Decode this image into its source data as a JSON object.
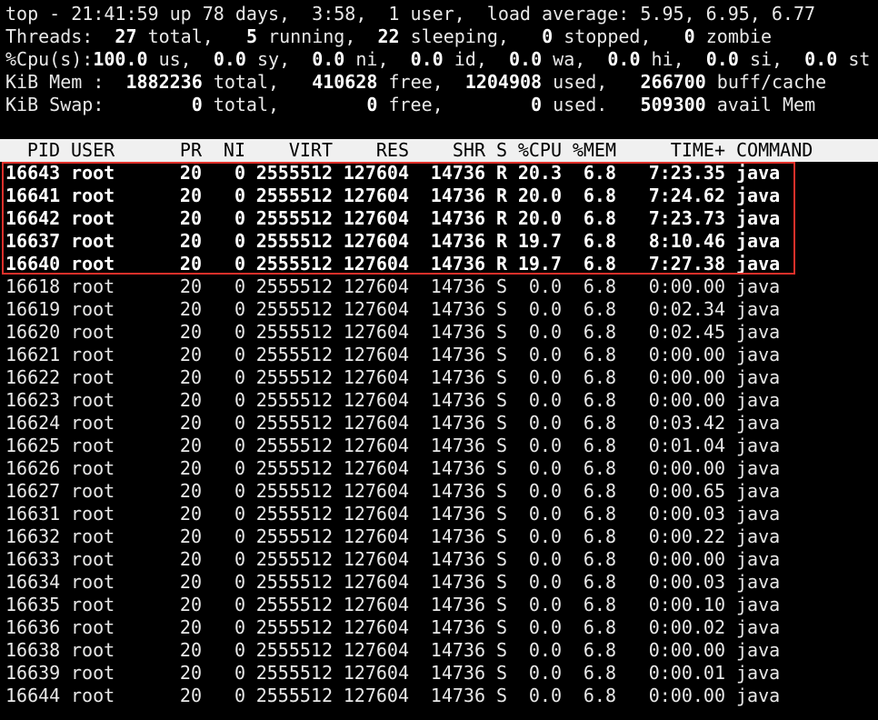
{
  "summary": {
    "line1": "top - 21:41:59 up 78 days,  3:58,  1 user,  load average: 5.95, 6.95, 6.77",
    "threads": {
      "label": "Threads:",
      "total": "27",
      "total_label": "total,",
      "running": "5",
      "running_label": "running,",
      "sleeping": "22",
      "sleeping_label": "sleeping,",
      "stopped": "0",
      "stopped_label": "stopped,",
      "zombie": "0",
      "zombie_label": "zombie"
    },
    "cpu": {
      "label": "%Cpu(s):",
      "us": "100.0",
      "us_label": "us,",
      "sy": "0.0",
      "sy_label": "sy,",
      "ni": "0.0",
      "ni_label": "ni,",
      "id": "0.0",
      "id_label": "id,",
      "wa": "0.0",
      "wa_label": "wa,",
      "hi": "0.0",
      "hi_label": "hi,",
      "si": "0.0",
      "si_label": "si,",
      "st": "0.0",
      "st_label": "st"
    },
    "mem": {
      "label": "KiB Mem :",
      "total": "1882236",
      "total_label": "total,",
      "free": "410628",
      "free_label": "free,",
      "used": "1204908",
      "used_label": "used,",
      "buff": "266700",
      "buff_label": "buff/cache"
    },
    "swap": {
      "label": "KiB Swap:",
      "total": "0",
      "total_label": "total,",
      "free": "0",
      "free_label": "free,",
      "used": "0",
      "used_label": "used.",
      "avail": "509300",
      "avail_label": "avail Mem"
    }
  },
  "table": {
    "columns": [
      "PID",
      "USER",
      "PR",
      "NI",
      "VIRT",
      "RES",
      "SHR",
      "S",
      "%CPU",
      "%MEM",
      "TIME+",
      "COMMAND"
    ],
    "rows": [
      {
        "pid": "16643",
        "user": "root",
        "pr": "20",
        "ni": "0",
        "virt": "2555512",
        "res": "127604",
        "shr": "14736",
        "s": "R",
        "cpu": "20.3",
        "mem": "6.8",
        "time": "7:23.35",
        "cmd": "java",
        "bold": true
      },
      {
        "pid": "16641",
        "user": "root",
        "pr": "20",
        "ni": "0",
        "virt": "2555512",
        "res": "127604",
        "shr": "14736",
        "s": "R",
        "cpu": "20.0",
        "mem": "6.8",
        "time": "7:24.62",
        "cmd": "java",
        "bold": true
      },
      {
        "pid": "16642",
        "user": "root",
        "pr": "20",
        "ni": "0",
        "virt": "2555512",
        "res": "127604",
        "shr": "14736",
        "s": "R",
        "cpu": "20.0",
        "mem": "6.8",
        "time": "7:23.73",
        "cmd": "java",
        "bold": true
      },
      {
        "pid": "16637",
        "user": "root",
        "pr": "20",
        "ni": "0",
        "virt": "2555512",
        "res": "127604",
        "shr": "14736",
        "s": "R",
        "cpu": "19.7",
        "mem": "6.8",
        "time": "8:10.46",
        "cmd": "java",
        "bold": true
      },
      {
        "pid": "16640",
        "user": "root",
        "pr": "20",
        "ni": "0",
        "virt": "2555512",
        "res": "127604",
        "shr": "14736",
        "s": "R",
        "cpu": "19.7",
        "mem": "6.8",
        "time": "7:27.38",
        "cmd": "java",
        "bold": true
      },
      {
        "pid": "16618",
        "user": "root",
        "pr": "20",
        "ni": "0",
        "virt": "2555512",
        "res": "127604",
        "shr": "14736",
        "s": "S",
        "cpu": "0.0",
        "mem": "6.8",
        "time": "0:00.00",
        "cmd": "java",
        "bold": false
      },
      {
        "pid": "16619",
        "user": "root",
        "pr": "20",
        "ni": "0",
        "virt": "2555512",
        "res": "127604",
        "shr": "14736",
        "s": "S",
        "cpu": "0.0",
        "mem": "6.8",
        "time": "0:02.34",
        "cmd": "java",
        "bold": false
      },
      {
        "pid": "16620",
        "user": "root",
        "pr": "20",
        "ni": "0",
        "virt": "2555512",
        "res": "127604",
        "shr": "14736",
        "s": "S",
        "cpu": "0.0",
        "mem": "6.8",
        "time": "0:02.45",
        "cmd": "java",
        "bold": false
      },
      {
        "pid": "16621",
        "user": "root",
        "pr": "20",
        "ni": "0",
        "virt": "2555512",
        "res": "127604",
        "shr": "14736",
        "s": "S",
        "cpu": "0.0",
        "mem": "6.8",
        "time": "0:00.00",
        "cmd": "java",
        "bold": false
      },
      {
        "pid": "16622",
        "user": "root",
        "pr": "20",
        "ni": "0",
        "virt": "2555512",
        "res": "127604",
        "shr": "14736",
        "s": "S",
        "cpu": "0.0",
        "mem": "6.8",
        "time": "0:00.00",
        "cmd": "java",
        "bold": false
      },
      {
        "pid": "16623",
        "user": "root",
        "pr": "20",
        "ni": "0",
        "virt": "2555512",
        "res": "127604",
        "shr": "14736",
        "s": "S",
        "cpu": "0.0",
        "mem": "6.8",
        "time": "0:00.00",
        "cmd": "java",
        "bold": false
      },
      {
        "pid": "16624",
        "user": "root",
        "pr": "20",
        "ni": "0",
        "virt": "2555512",
        "res": "127604",
        "shr": "14736",
        "s": "S",
        "cpu": "0.0",
        "mem": "6.8",
        "time": "0:03.42",
        "cmd": "java",
        "bold": false
      },
      {
        "pid": "16625",
        "user": "root",
        "pr": "20",
        "ni": "0",
        "virt": "2555512",
        "res": "127604",
        "shr": "14736",
        "s": "S",
        "cpu": "0.0",
        "mem": "6.8",
        "time": "0:01.04",
        "cmd": "java",
        "bold": false
      },
      {
        "pid": "16626",
        "user": "root",
        "pr": "20",
        "ni": "0",
        "virt": "2555512",
        "res": "127604",
        "shr": "14736",
        "s": "S",
        "cpu": "0.0",
        "mem": "6.8",
        "time": "0:00.00",
        "cmd": "java",
        "bold": false
      },
      {
        "pid": "16627",
        "user": "root",
        "pr": "20",
        "ni": "0",
        "virt": "2555512",
        "res": "127604",
        "shr": "14736",
        "s": "S",
        "cpu": "0.0",
        "mem": "6.8",
        "time": "0:00.65",
        "cmd": "java",
        "bold": false
      },
      {
        "pid": "16631",
        "user": "root",
        "pr": "20",
        "ni": "0",
        "virt": "2555512",
        "res": "127604",
        "shr": "14736",
        "s": "S",
        "cpu": "0.0",
        "mem": "6.8",
        "time": "0:00.03",
        "cmd": "java",
        "bold": false
      },
      {
        "pid": "16632",
        "user": "root",
        "pr": "20",
        "ni": "0",
        "virt": "2555512",
        "res": "127604",
        "shr": "14736",
        "s": "S",
        "cpu": "0.0",
        "mem": "6.8",
        "time": "0:00.22",
        "cmd": "java",
        "bold": false
      },
      {
        "pid": "16633",
        "user": "root",
        "pr": "20",
        "ni": "0",
        "virt": "2555512",
        "res": "127604",
        "shr": "14736",
        "s": "S",
        "cpu": "0.0",
        "mem": "6.8",
        "time": "0:00.00",
        "cmd": "java",
        "bold": false
      },
      {
        "pid": "16634",
        "user": "root",
        "pr": "20",
        "ni": "0",
        "virt": "2555512",
        "res": "127604",
        "shr": "14736",
        "s": "S",
        "cpu": "0.0",
        "mem": "6.8",
        "time": "0:00.03",
        "cmd": "java",
        "bold": false
      },
      {
        "pid": "16635",
        "user": "root",
        "pr": "20",
        "ni": "0",
        "virt": "2555512",
        "res": "127604",
        "shr": "14736",
        "s": "S",
        "cpu": "0.0",
        "mem": "6.8",
        "time": "0:00.10",
        "cmd": "java",
        "bold": false
      },
      {
        "pid": "16636",
        "user": "root",
        "pr": "20",
        "ni": "0",
        "virt": "2555512",
        "res": "127604",
        "shr": "14736",
        "s": "S",
        "cpu": "0.0",
        "mem": "6.8",
        "time": "0:00.02",
        "cmd": "java",
        "bold": false
      },
      {
        "pid": "16638",
        "user": "root",
        "pr": "20",
        "ni": "0",
        "virt": "2555512",
        "res": "127604",
        "shr": "14736",
        "s": "S",
        "cpu": "0.0",
        "mem": "6.8",
        "time": "0:00.00",
        "cmd": "java",
        "bold": false
      },
      {
        "pid": "16639",
        "user": "root",
        "pr": "20",
        "ni": "0",
        "virt": "2555512",
        "res": "127604",
        "shr": "14736",
        "s": "S",
        "cpu": "0.0",
        "mem": "6.8",
        "time": "0:00.01",
        "cmd": "java",
        "bold": false
      },
      {
        "pid": "16644",
        "user": "root",
        "pr": "20",
        "ni": "0",
        "virt": "2555512",
        "res": "127604",
        "shr": "14736",
        "s": "S",
        "cpu": "0.0",
        "mem": "6.8",
        "time": "0:00.00",
        "cmd": "java",
        "bold": false
      }
    ]
  },
  "colors": {
    "background": "#000000",
    "text": "#ffffff",
    "header_bg": "#f0f0f0",
    "highlight_border": "#e0302a"
  }
}
